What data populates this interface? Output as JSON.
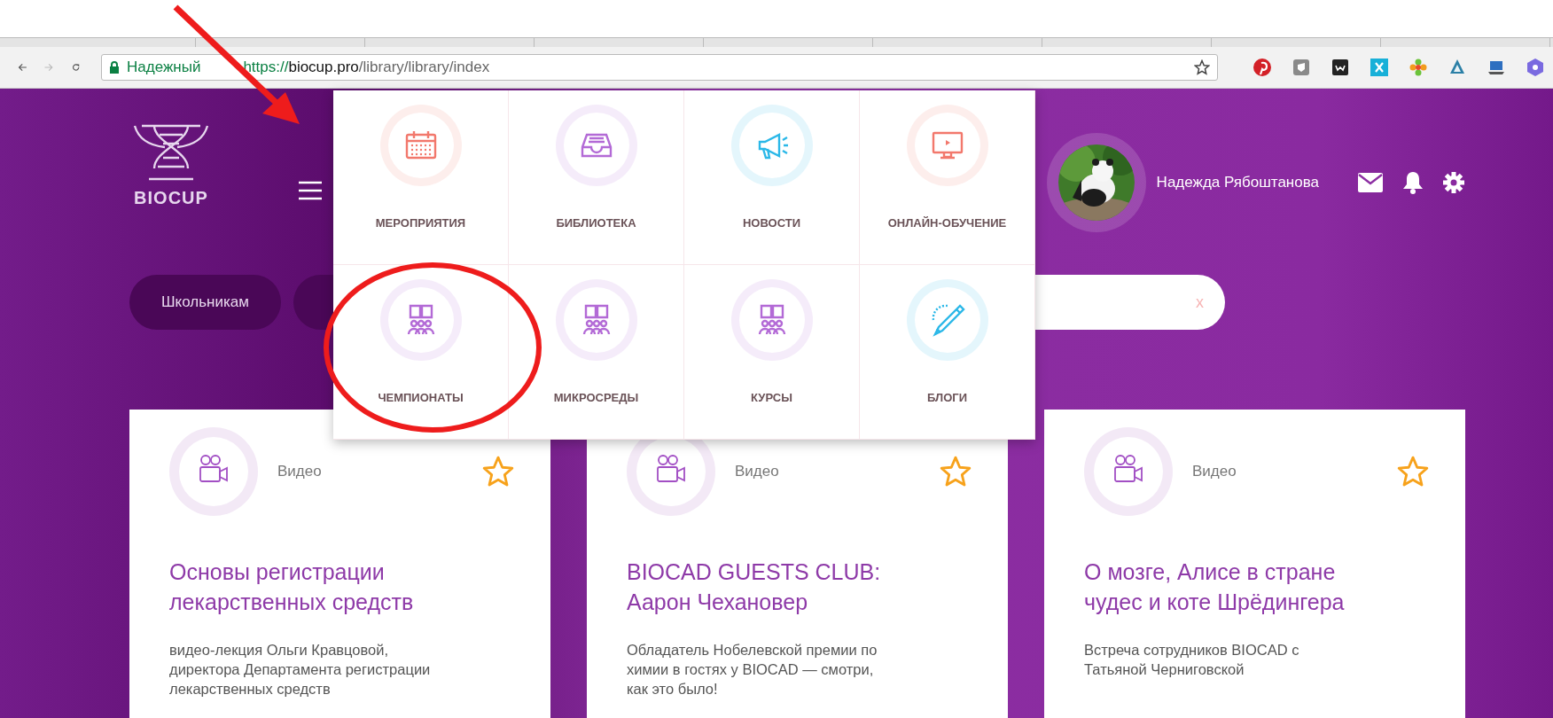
{
  "browser": {
    "address": {
      "secure_label": "Надежный",
      "scheme": "https://",
      "host": "biocup.pro",
      "path": "/library/library/index"
    }
  },
  "header": {
    "logo_text": "BIOCUP",
    "user_name": "Надежда Рябоштанова"
  },
  "filters": [
    {
      "label": "Школьникам"
    }
  ],
  "search": {
    "clear": "x"
  },
  "menu": [
    {
      "label": "МЕРОПРИЯТИЯ",
      "kind": "calendar",
      "color": "#f2786c"
    },
    {
      "label": "БИБЛИОТЕКА",
      "kind": "tray",
      "color": "#b36ad6"
    },
    {
      "label": "НОВОСТИ",
      "kind": "megaphone",
      "color": "#2bb8e8"
    },
    {
      "label": "ОНЛАЙН-ОБУЧЕНИЕ",
      "kind": "monitor",
      "color": "#f2786c"
    },
    {
      "label": "ЧЕМПИОНАТЫ",
      "kind": "readers",
      "color": "#b36ad6"
    },
    {
      "label": "МИКРОСРЕДЫ",
      "kind": "readers",
      "color": "#b36ad6"
    },
    {
      "label": "КУРСЫ",
      "kind": "readers",
      "color": "#b36ad6"
    },
    {
      "label": "БЛОГИ",
      "kind": "pen",
      "color": "#2bb8e8"
    }
  ],
  "cards": [
    {
      "type": "Видео",
      "starred": false,
      "title": "Основы регистрации лекарственных средств",
      "description": "видео-лекция Ольги Кравцовой, директора Департамента регистрации лекарственных средств"
    },
    {
      "type": "Видео",
      "starred": false,
      "title": "BIOCAD GUESTS CLUB: Аарон Чехановер",
      "description": "Обладатель Нобелевской премии по химии в гостях у BIOCAD — смотри, как это было!"
    },
    {
      "type": "Видео",
      "starred": false,
      "title": "О мозге, Алисе в стране чудес и коте Шрёдингера",
      "description": "Встреча сотрудников BIOCAD с Татьяной Черниговской"
    }
  ]
}
